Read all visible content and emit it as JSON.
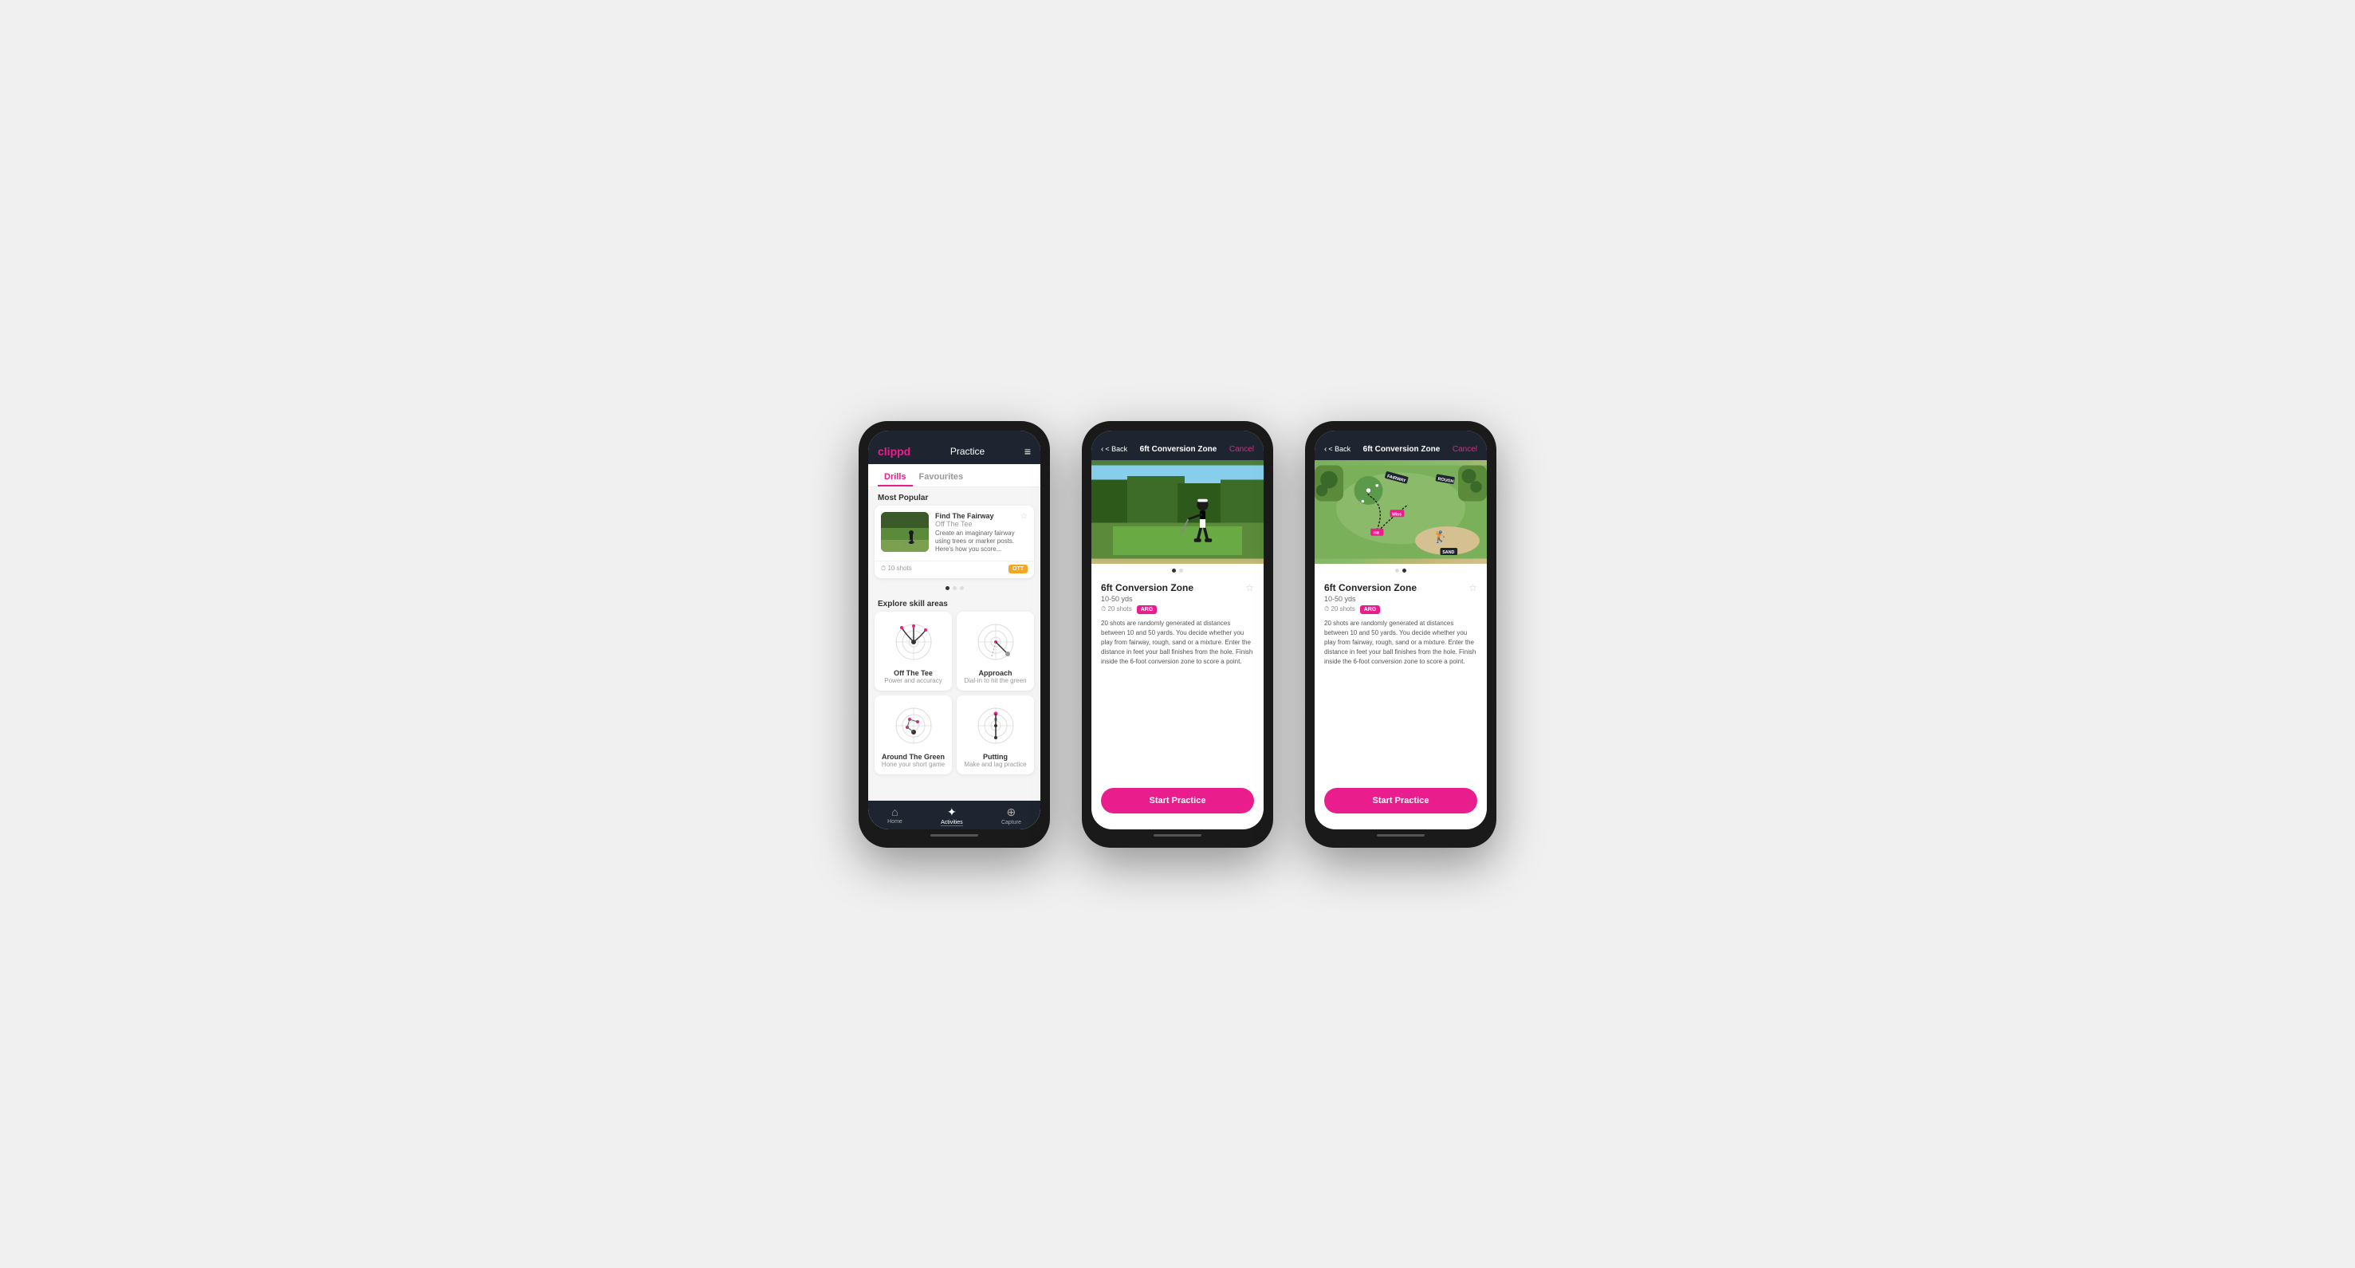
{
  "app": {
    "name": "clippd"
  },
  "phone1": {
    "header": {
      "logo": "clippd",
      "title": "Practice",
      "menu_icon": "≡"
    },
    "tabs": [
      {
        "label": "Drills",
        "active": true
      },
      {
        "label": "Favourites",
        "active": false
      }
    ],
    "most_popular_label": "Most Popular",
    "featured_drill": {
      "title": "Find The Fairway",
      "subtitle": "Off The Tee",
      "description": "Create an imaginary fairway using trees or marker posts. Here's how you score...",
      "shots": "10 shots",
      "badge": "OTT"
    },
    "explore_label": "Explore skill areas",
    "skills": [
      {
        "name": "Off The Tee",
        "desc": "Power and accuracy"
      },
      {
        "name": "Approach",
        "desc": "Dial-in to hit the green"
      },
      {
        "name": "Around The Green",
        "desc": "Hone your short game"
      },
      {
        "name": "Putting",
        "desc": "Make and lag practice"
      }
    ],
    "nav": [
      {
        "label": "Home",
        "icon": "⌂",
        "active": false
      },
      {
        "label": "Activities",
        "icon": "✦",
        "active": true
      },
      {
        "label": "Capture",
        "icon": "⊕",
        "active": false
      }
    ]
  },
  "phone2": {
    "header": {
      "back_label": "< Back",
      "title": "6ft Conversion Zone",
      "cancel_label": "Cancel"
    },
    "drill": {
      "title": "6ft Conversion Zone",
      "distance": "10-50 yds",
      "shots": "20 shots",
      "badge": "ARG",
      "description": "20 shots are randomly generated at distances between 10 and 50 yards. You decide whether you play from fairway, rough, sand or a mixture. Enter the distance in feet your ball finishes from the hole. Finish inside the 6-foot conversion zone to score a point.",
      "cta": "Start Practice"
    }
  },
  "phone3": {
    "header": {
      "back_label": "< Back",
      "title": "6ft Conversion Zone",
      "cancel_label": "Cancel"
    },
    "drill": {
      "title": "6ft Conversion Zone",
      "distance": "10-50 yds",
      "shots": "20 shots",
      "badge": "ARG",
      "description": "20 shots are randomly generated at distances between 10 and 50 yards. You decide whether you play from fairway, rough, sand or a mixture. Enter the distance in feet your ball finishes from the hole. Finish inside the 6-foot conversion zone to score a point.",
      "cta": "Start Practice"
    }
  },
  "icons": {
    "clock": "⏱",
    "star_empty": "☆",
    "chevron_left": "‹",
    "home": "⌂",
    "activities": "✦",
    "capture": "⊕"
  }
}
